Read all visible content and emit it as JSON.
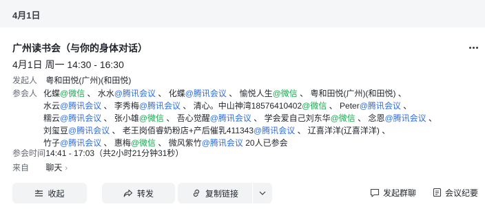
{
  "date_header": "4月1日",
  "event": {
    "title": "广州读书会（与你的身体对话）",
    "time": "4月1日 周一 14:30 - 16:30",
    "organizer_label": "发起人",
    "organizer": "粤和田悦(广州)(和田悦)",
    "participants_label": "参会人",
    "participant_lines": [
      [
        {
          "t": "化蝶"
        },
        {
          "t": "@微信",
          "c": "wx"
        },
        {
          "t": " 、 水水"
        },
        {
          "t": "@腾讯会议",
          "c": "tm"
        },
        {
          "t": " 、 化蝶"
        },
        {
          "t": "@腾讯会议",
          "c": "tm"
        },
        {
          "t": " 、 愉悦人生"
        },
        {
          "t": "@微信",
          "c": "wx"
        },
        {
          "t": " 、 粤和田悦(广州)(和田悦) 、"
        }
      ],
      [
        {
          "t": "水云"
        },
        {
          "t": "@腾讯会议",
          "c": "tm"
        },
        {
          "t": " 、 李秀梅"
        },
        {
          "t": "@腾讯会议",
          "c": "tm"
        },
        {
          "t": " 、 清心。中山神湾18576410402"
        },
        {
          "t": "@微信",
          "c": "wx"
        },
        {
          "t": " 、 Peter"
        },
        {
          "t": "@腾讯会议",
          "c": "tm"
        },
        {
          "t": " 、"
        }
      ],
      [
        {
          "t": "糯云"
        },
        {
          "t": "@腾讯会议",
          "c": "tm"
        },
        {
          "t": " 、 张小雄"
        },
        {
          "t": "@微信",
          "c": "wx"
        },
        {
          "t": " 、 吾心觉醒"
        },
        {
          "t": "@腾讯会议",
          "c": "tm"
        },
        {
          "t": " 、 学会爱自己刘东华"
        },
        {
          "t": "@微信",
          "c": "wx"
        },
        {
          "t": " 、 念恩"
        },
        {
          "t": "@腾讯会议",
          "c": "tm"
        },
        {
          "t": " 、"
        }
      ],
      [
        {
          "t": "刘玺豆"
        },
        {
          "t": "@腾讯会议",
          "c": "tm"
        },
        {
          "t": " 、 老王岗佰睿奶粉店+产后催乳411343"
        },
        {
          "t": "@腾讯会议",
          "c": "tm"
        },
        {
          "t": " 、 辽喜洋洋(辽喜洋洋) 、"
        }
      ],
      [
        {
          "t": "竹子"
        },
        {
          "t": "@腾讯会议",
          "c": "tm"
        },
        {
          "t": " 、 惠梅"
        },
        {
          "t": "@微信",
          "c": "wx"
        },
        {
          "t": " 、 微风紫竹"
        },
        {
          "t": "@腾讯会议",
          "c": "tm"
        },
        {
          "t": " 20人已参会"
        }
      ]
    ],
    "attend_label": "参会时间",
    "attend_time": "14:41 - 17:03（共2小时21分钟31秒）",
    "from_label": "来自",
    "from_source": "聊天",
    "from_chevron": "›"
  },
  "actions": {
    "collapse": "收起",
    "forward": "转发",
    "copy_link": "复制链接",
    "group_chat": "发起群聊",
    "minutes": "会议纪要"
  },
  "colors": {
    "wechat": "#18a94f",
    "tencent_meeting": "#2f6de8",
    "header_bg": "#f5f6f7",
    "button_bg": "#f2f3f5"
  }
}
